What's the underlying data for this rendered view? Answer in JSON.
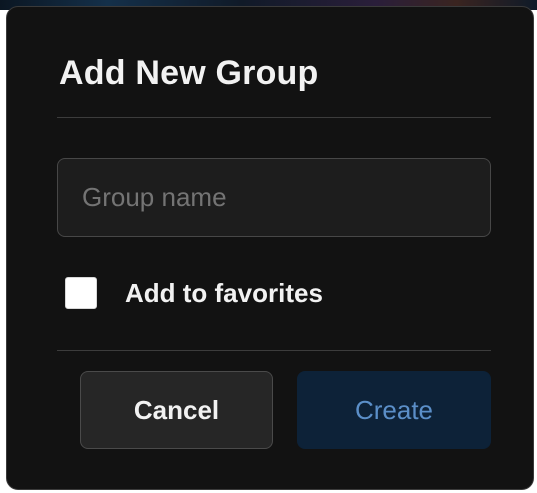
{
  "dialog": {
    "title": "Add New Group",
    "name_input": {
      "placeholder": "Group name",
      "value": ""
    },
    "favorites_checkbox": {
      "label": "Add to favorites",
      "checked": false
    },
    "buttons": {
      "cancel_label": "Cancel",
      "create_label": "Create"
    }
  },
  "colors": {
    "dialog_background": "#121212",
    "create_button_background": "#0d2238",
    "create_button_text": "#5b8fc8",
    "cancel_button_background": "#262626"
  }
}
